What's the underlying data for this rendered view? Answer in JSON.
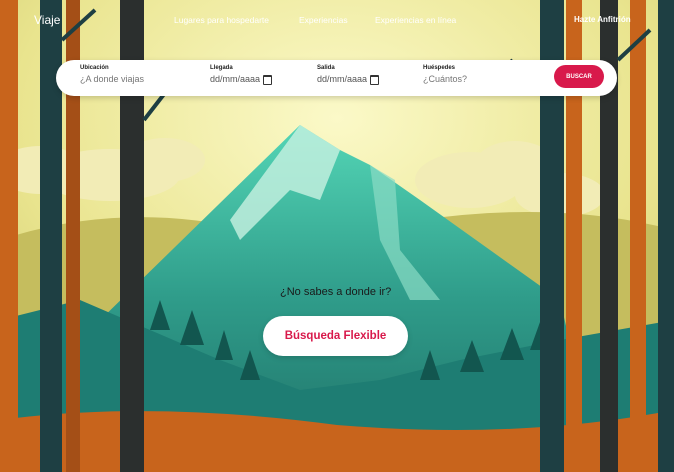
{
  "header": {
    "brand": "Viaje",
    "links": [
      "Lugares para hospedarte",
      "Experiencias",
      "Experiencias en línea"
    ],
    "host_link": "Hazte Anfitrión"
  },
  "search": {
    "location_label": "Ubicación",
    "location_placeholder": "¿A donde viajas",
    "arrival_label": "Llegada",
    "arrival_value": "dd/mm/aaaa",
    "departure_label": "Salida",
    "departure_value": "dd/mm/aaaa",
    "guests_label": "Huéspedes",
    "guests_placeholder": "¿Cuántos?",
    "button_label": "BUSCAR"
  },
  "hero": {
    "question": "¿No sabes a donde ir?",
    "flexible_button": "Búsqueda Flexible"
  },
  "colors": {
    "accent": "#d8194b",
    "sky": "#e9e48e",
    "mountain": "#2f9c8a",
    "trunk": "#c8641c"
  },
  "icons": [
    "calendar-icon"
  ]
}
